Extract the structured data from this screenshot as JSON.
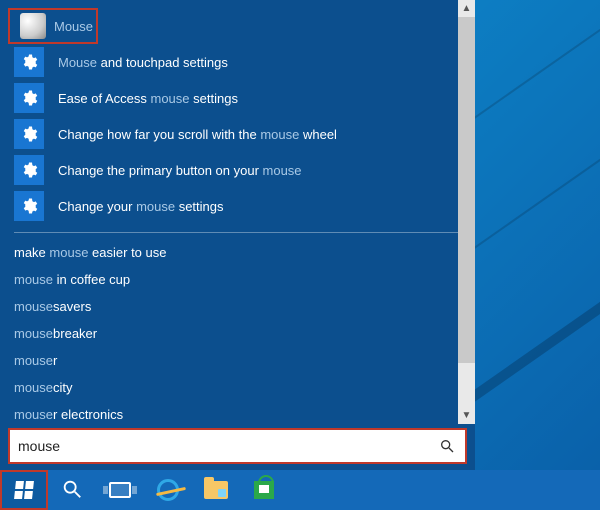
{
  "colors": {
    "panel": "#0c4f8e",
    "accent": "#1976d2",
    "taskbar": "#1469b8",
    "highlight_box": "#c0392b"
  },
  "top_result": {
    "label": "Mouse",
    "icon": "mouse-device-icon"
  },
  "settings": [
    {
      "pre": "",
      "match": "Mouse",
      "post": " and touchpad settings"
    },
    {
      "pre": "Ease of Access ",
      "match": "mouse",
      "post": " settings"
    },
    {
      "pre": "Change how far you scroll with the ",
      "match": "mouse",
      "post": " wheel"
    },
    {
      "pre": "Change the primary button on your ",
      "match": "mouse",
      "post": ""
    },
    {
      "pre": "Change your ",
      "match": "mouse",
      "post": " settings"
    }
  ],
  "suggestions": [
    {
      "pre": "make ",
      "match": "mouse",
      "post": " easier to use"
    },
    {
      "pre": "",
      "match": "mouse",
      "post": " in coffee cup"
    },
    {
      "pre": "",
      "match": "mouse",
      "post": "savers"
    },
    {
      "pre": "",
      "match": "mouse",
      "post": "breaker"
    },
    {
      "pre": "",
      "match": "mouse",
      "post": "r"
    },
    {
      "pre": "",
      "match": "mouse",
      "post": "city"
    },
    {
      "pre": "",
      "match": "mouse",
      "post": "r electronics"
    }
  ],
  "search": {
    "value": "mouse",
    "placeholder": "Search"
  },
  "taskbar": {
    "start": "Start",
    "search": "Search",
    "taskview": "Task View",
    "ie": "Internet Explorer",
    "explorer": "File Explorer",
    "store": "Store"
  }
}
